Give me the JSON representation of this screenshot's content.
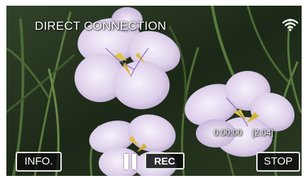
{
  "header": {
    "title": "DIRECT CONNECTION",
    "wifi_icon": "wifi-icon"
  },
  "recording": {
    "elapsed": "0:00:00",
    "remaining": "[2:04]"
  },
  "controls": {
    "info_label": "INFO.",
    "pause_icon": "pause-icon",
    "rec_label": "REC",
    "stop_label": "STOP"
  },
  "colors": {
    "button_border": "#e8e8e8",
    "button_bg": "#0c0c0c",
    "text": "#ffffff"
  }
}
